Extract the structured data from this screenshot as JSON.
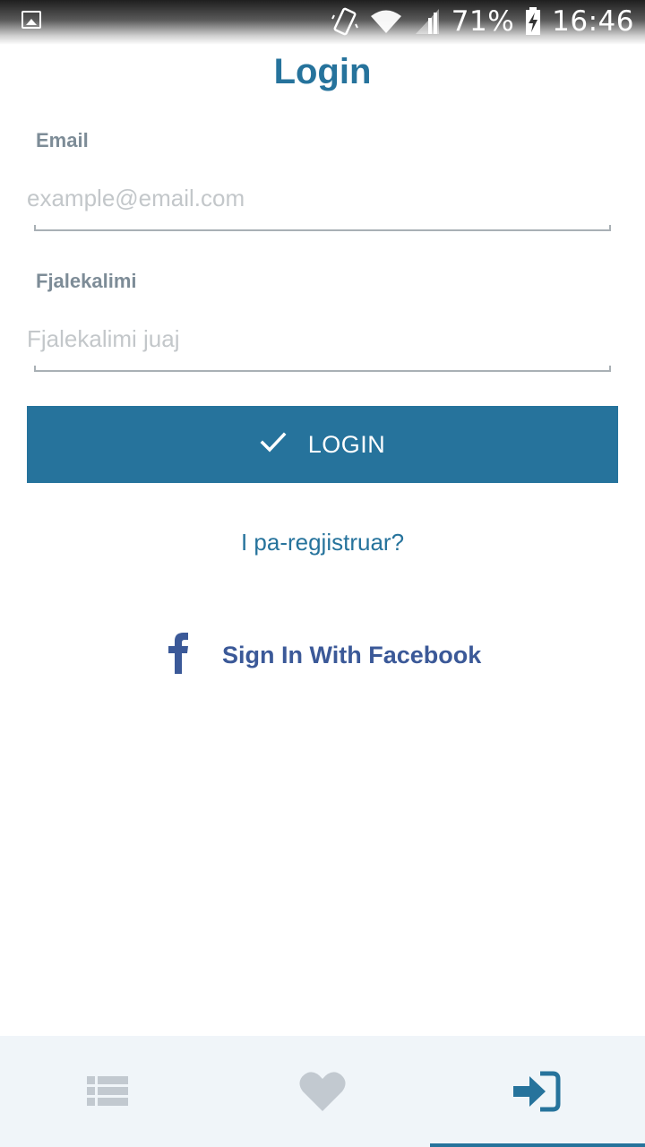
{
  "status_bar": {
    "battery": "71%",
    "time": "16:46",
    "icons": [
      "gallery-icon",
      "vibrate-icon",
      "wifi-icon",
      "signal-icon",
      "battery-charging-icon"
    ]
  },
  "page": {
    "title": "Login"
  },
  "form": {
    "email": {
      "label": "Email",
      "placeholder": "example@email.com",
      "value": ""
    },
    "password": {
      "label": "Fjalekalimi",
      "placeholder": "Fjalekalimi juaj",
      "value": ""
    }
  },
  "actions": {
    "login_label": "LOGIN",
    "login_icon": "check-icon",
    "register_link": "I pa-regjistruar?",
    "facebook_label": "Sign In With Facebook",
    "facebook_icon": "facebook-icon"
  },
  "bottom_nav": {
    "items": [
      {
        "icon": "list-icon",
        "active": false
      },
      {
        "icon": "heart-icon",
        "active": false
      },
      {
        "icon": "sign-in-icon",
        "active": true
      }
    ]
  },
  "colors": {
    "primary": "#26739c",
    "facebook": "#3b5998",
    "label": "#7d8c97",
    "placeholder": "#c3c7ca",
    "nav_inactive": "#c2c9d0",
    "nav_background": "#f0f5f9"
  }
}
